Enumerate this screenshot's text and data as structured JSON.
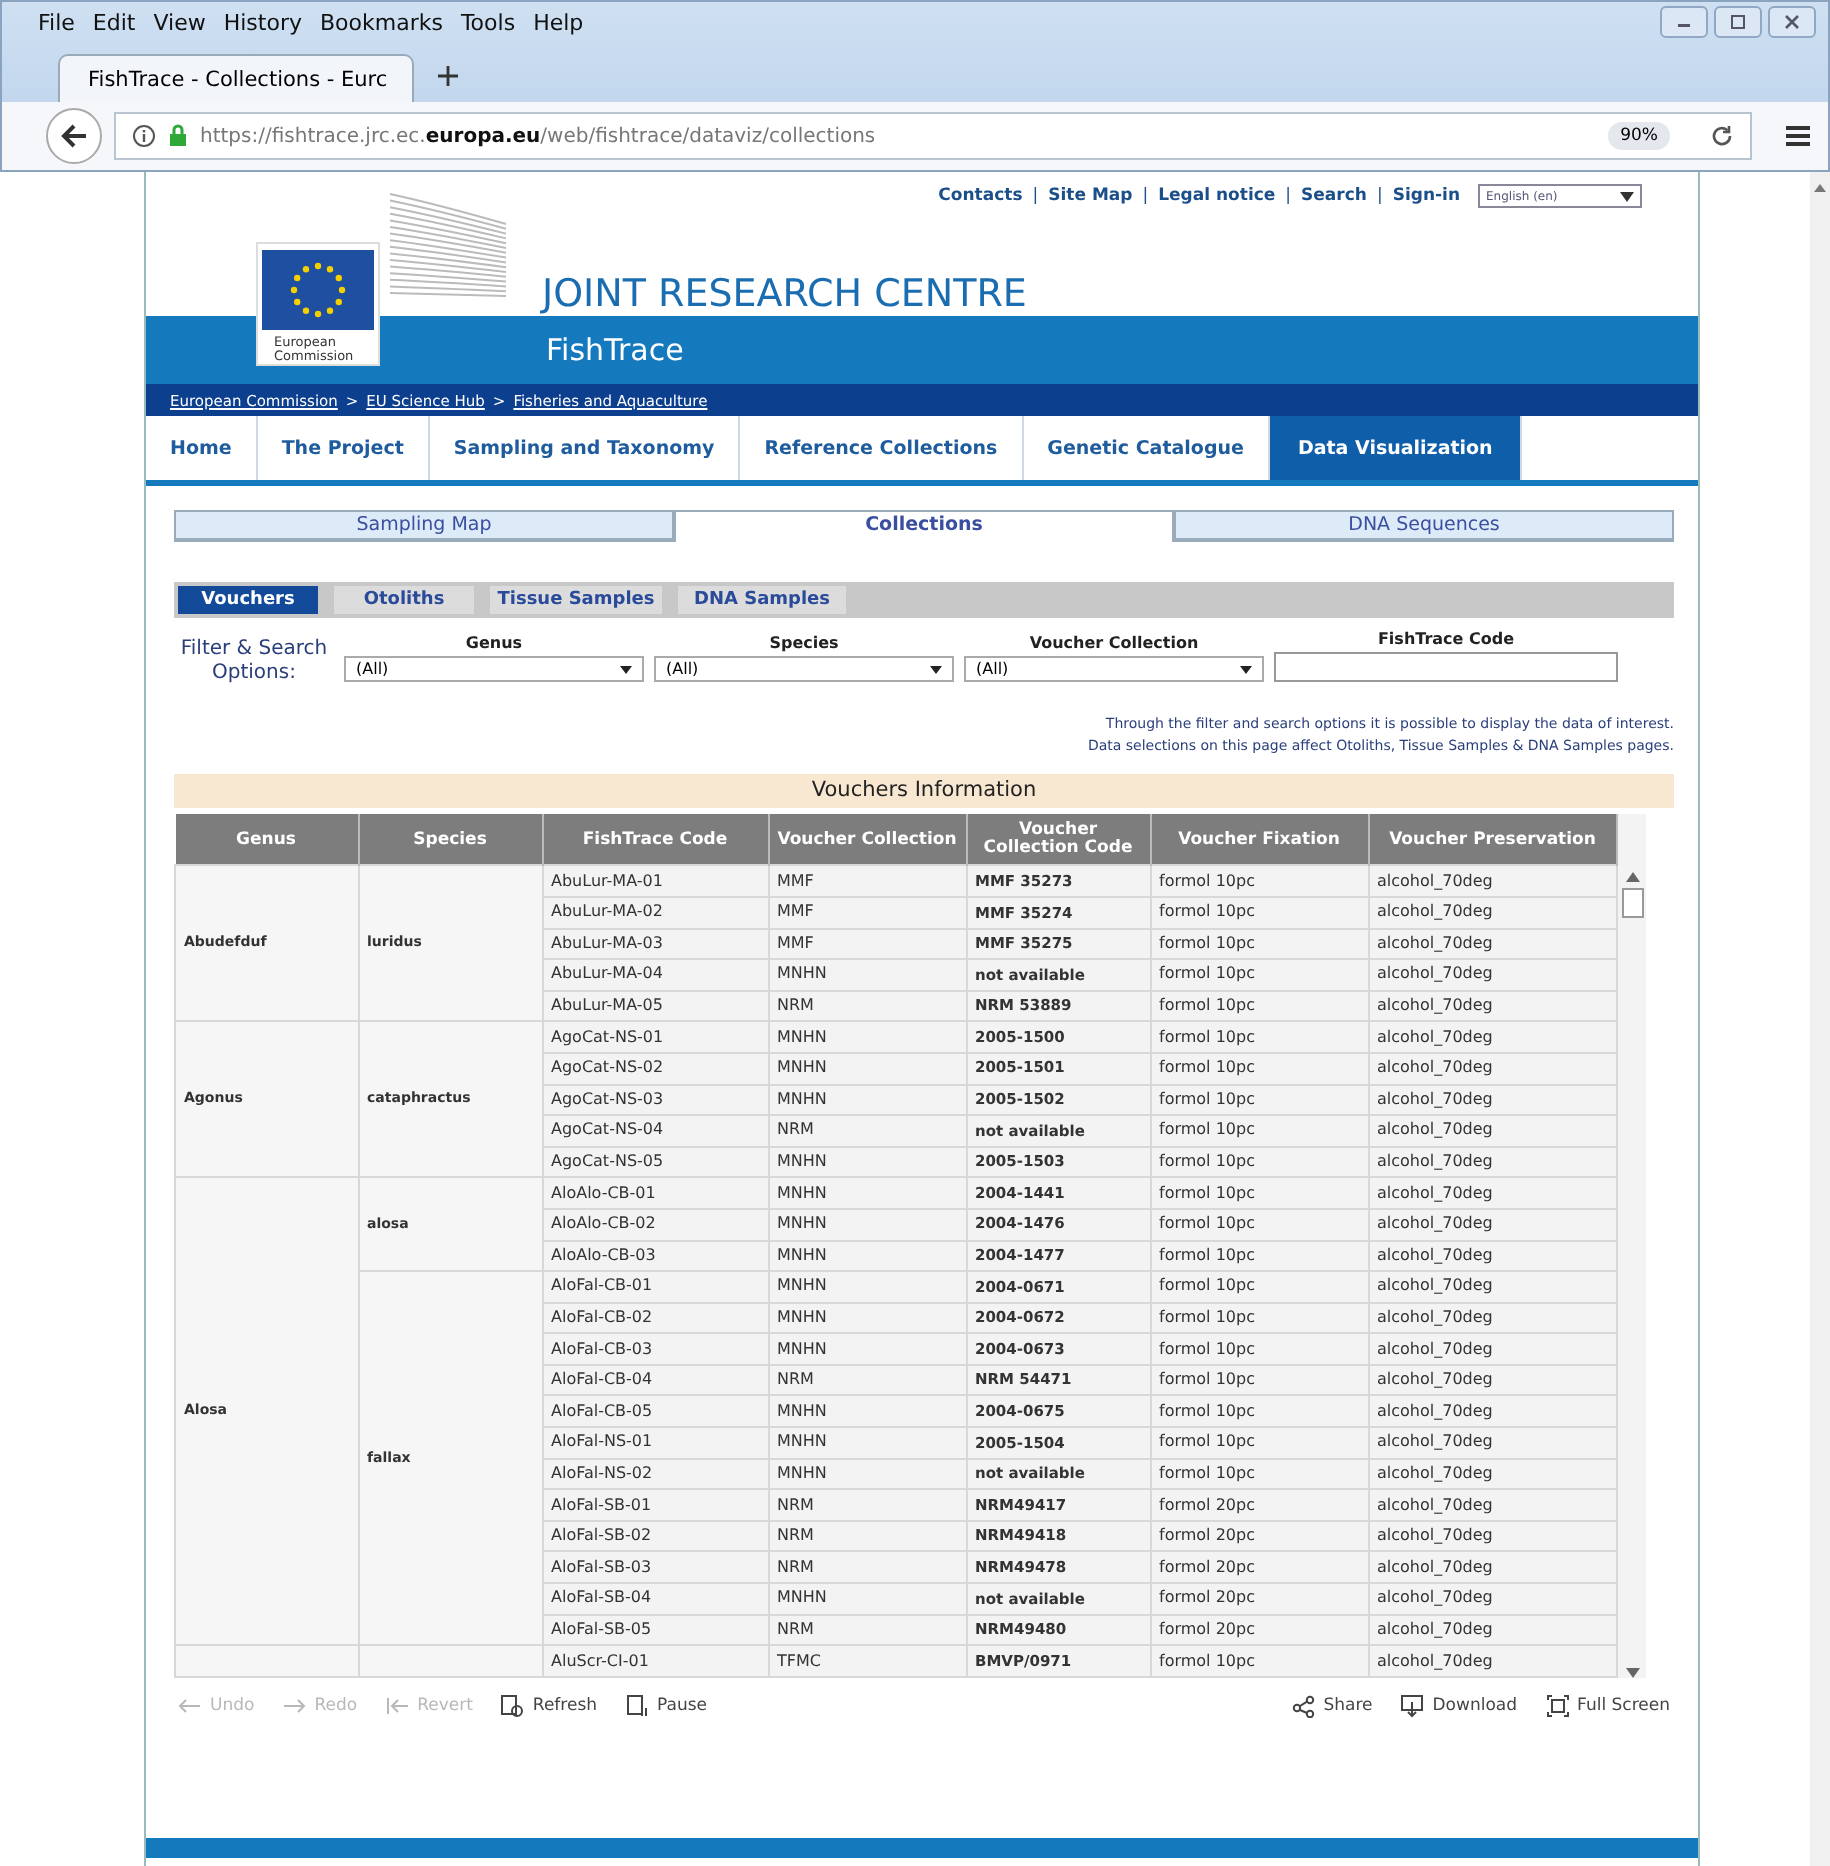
{
  "browser": {
    "menu": [
      "File",
      "Edit",
      "View",
      "History",
      "Bookmarks",
      "Tools",
      "Help"
    ],
    "tabs": [
      {
        "title": "FishTrace - Collections - Eurc",
        "selected": true
      }
    ],
    "url_prefix": "https://fishtrace.jrc.ec.",
    "url_domain": "europa.eu",
    "url_path": "/web/fishtrace/dataviz/collections",
    "zoom": "90%"
  },
  "top_links": [
    "Contacts",
    "Site Map",
    "Legal notice",
    "Search",
    "Sign-in"
  ],
  "top_links_separator": "|",
  "language": "English (en)",
  "logo_text": "European Commission",
  "header_title": "JOINT RESEARCH CENTRE",
  "header_subtitle": "FishTrace",
  "breadcrumb": [
    "European Commission",
    "EU Science Hub",
    "Fisheries and Aquaculture"
  ],
  "breadcrumb_separator": ">",
  "nav": [
    {
      "label": "Home",
      "selected": false
    },
    {
      "label": "The Project",
      "selected": false
    },
    {
      "label": "Sampling and Taxonomy",
      "selected": false
    },
    {
      "label": "Reference Collections",
      "selected": false
    },
    {
      "label": "Genetic Catalogue",
      "selected": false
    },
    {
      "label": "Data Visualization",
      "selected": true
    }
  ],
  "view_tabs": [
    {
      "label": "Sampling Map",
      "selected": false
    },
    {
      "label": "Collections",
      "selected": true
    },
    {
      "label": "DNA Sequences",
      "selected": false
    }
  ],
  "sample_tabs": [
    {
      "label": "Vouchers",
      "selected": true
    },
    {
      "label": "Otoliths",
      "selected": false
    },
    {
      "label": "Tissue Samples",
      "selected": false
    },
    {
      "label": "DNA Samples",
      "selected": false
    }
  ],
  "filter_label": "Filter & Search Options:",
  "filters": [
    {
      "kind": "dropdown",
      "label": "Genus",
      "value": "(All)"
    },
    {
      "kind": "dropdown",
      "label": "Species",
      "value": "(All)"
    },
    {
      "kind": "dropdown",
      "label": "Voucher Collection",
      "value": "(All)"
    },
    {
      "kind": "text",
      "label": "FishTrace Code"
    }
  ],
  "notes": [
    "Through the filter and search options it is possible to display the data of interest.",
    "Data selections on this page affect Otoliths, Tissue Samples & DNA Samples pages."
  ],
  "table": {
    "title": "Vouchers Information",
    "columns": [
      "Genus",
      "Species",
      "FishTrace Code",
      "Voucher Collection",
      "Voucher Collection Code",
      "Voucher Fixation",
      "Voucher Preservation"
    ],
    "groups": [
      {
        "genus": "Abudefduf",
        "species": [
          {
            "name": "luridus",
            "rows": [
              [
                "AbuLur-MA-01",
                "MMF",
                "MMF 35273",
                "formol 10pc",
                "alcohol_70deg"
              ],
              [
                "AbuLur-MA-02",
                "MMF",
                "MMF 35274",
                "formol 10pc",
                "alcohol_70deg"
              ],
              [
                "AbuLur-MA-03",
                "MMF",
                "MMF 35275",
                "formol 10pc",
                "alcohol_70deg"
              ],
              [
                "AbuLur-MA-04",
                "MNHN",
                "not available",
                "formol 10pc",
                "alcohol_70deg"
              ],
              [
                "AbuLur-MA-05",
                "NRM",
                "NRM 53889",
                "formol 10pc",
                "alcohol_70deg"
              ]
            ]
          }
        ]
      },
      {
        "genus": "Agonus",
        "species": [
          {
            "name": "cataphractus",
            "rows": [
              [
                "AgoCat-NS-01",
                "MNHN",
                "2005-1500",
                "formol 10pc",
                "alcohol_70deg"
              ],
              [
                "AgoCat-NS-02",
                "MNHN",
                "2005-1501",
                "formol 10pc",
                "alcohol_70deg"
              ],
              [
                "AgoCat-NS-03",
                "MNHN",
                "2005-1502",
                "formol 10pc",
                "alcohol_70deg"
              ],
              [
                "AgoCat-NS-04",
                "NRM",
                "not available",
                "formol 10pc",
                "alcohol_70deg"
              ],
              [
                "AgoCat-NS-05",
                "MNHN",
                "2005-1503",
                "formol 10pc",
                "alcohol_70deg"
              ]
            ]
          }
        ]
      },
      {
        "genus": "Alosa",
        "species": [
          {
            "name": "alosa",
            "rows": [
              [
                "AloAlo-CB-01",
                "MNHN",
                "2004-1441",
                "formol 10pc",
                "alcohol_70deg"
              ],
              [
                "AloAlo-CB-02",
                "MNHN",
                "2004-1476",
                "formol 10pc",
                "alcohol_70deg"
              ],
              [
                "AloAlo-CB-03",
                "MNHN",
                "2004-1477",
                "formol 10pc",
                "alcohol_70deg"
              ]
            ]
          },
          {
            "name": "fallax",
            "rows": [
              [
                "AloFal-CB-01",
                "MNHN",
                "2004-0671",
                "formol 10pc",
                "alcohol_70deg"
              ],
              [
                "AloFal-CB-02",
                "MNHN",
                "2004-0672",
                "formol 10pc",
                "alcohol_70deg"
              ],
              [
                "AloFal-CB-03",
                "MNHN",
                "2004-0673",
                "formol 10pc",
                "alcohol_70deg"
              ],
              [
                "AloFal-CB-04",
                "NRM",
                "NRM 54471",
                "formol 10pc",
                "alcohol_70deg"
              ],
              [
                "AloFal-CB-05",
                "MNHN",
                "2004-0675",
                "formol 10pc",
                "alcohol_70deg"
              ],
              [
                "AloFal-NS-01",
                "MNHN",
                "2005-1504",
                "formol 10pc",
                "alcohol_70deg"
              ],
              [
                "AloFal-NS-02",
                "MNHN",
                "not available",
                "formol 10pc",
                "alcohol_70deg"
              ],
              [
                "AloFal-SB-01",
                "NRM",
                "NRM49417",
                "formol 20pc",
                "alcohol_70deg"
              ],
              [
                "AloFal-SB-02",
                "NRM",
                "NRM49418",
                "formol 20pc",
                "alcohol_70deg"
              ],
              [
                "AloFal-SB-03",
                "NRM",
                "NRM49478",
                "formol 20pc",
                "alcohol_70deg"
              ],
              [
                "AloFal-SB-04",
                "MNHN",
                "not available",
                "formol 20pc",
                "alcohol_70deg"
              ],
              [
                "AloFal-SB-05",
                "NRM",
                "NRM49480",
                "formol 20pc",
                "alcohol_70deg"
              ]
            ]
          }
        ]
      },
      {
        "species": [
          {
            "rows": [
              [
                "AluScr-CI-01",
                "TFMC",
                "BMVP/0971",
                "formol 10pc",
                "alcohol_70deg"
              ]
            ]
          }
        ]
      }
    ]
  },
  "toolbar_left": [
    {
      "kind": "undo",
      "label": "Undo",
      "disabled": true
    },
    {
      "kind": "redo",
      "label": "Redo",
      "disabled": true
    },
    {
      "kind": "revert",
      "label": "Revert",
      "disabled": true
    },
    {
      "kind": "refresh",
      "label": "Refresh",
      "disabled": false
    },
    {
      "kind": "pause",
      "label": "Pause",
      "disabled": false
    }
  ],
  "toolbar_right": [
    {
      "kind": "share",
      "label": "Share",
      "disabled": false
    },
    {
      "kind": "download",
      "label": "Download",
      "disabled": false
    },
    {
      "kind": "fullscreen",
      "label": "Full Screen",
      "disabled": false
    }
  ]
}
